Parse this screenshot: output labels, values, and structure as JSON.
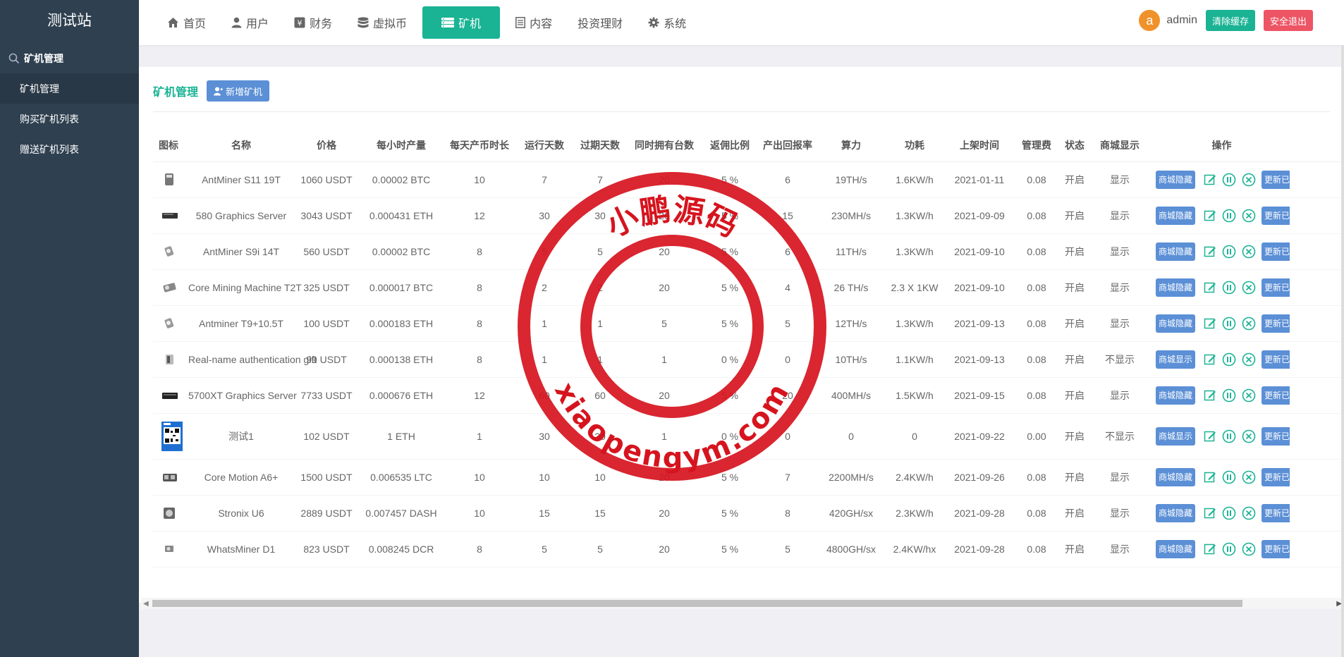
{
  "sidebar": {
    "site_title": "测试站",
    "section": "矿机管理",
    "items": [
      {
        "label": "矿机管理"
      },
      {
        "label": "购买矿机列表"
      },
      {
        "label": "赠送矿机列表"
      }
    ]
  },
  "topnav": {
    "items": [
      {
        "label": "首页",
        "icon": "home-icon"
      },
      {
        "label": "用户",
        "icon": "user-icon"
      },
      {
        "label": "财务",
        "icon": "yen-icon"
      },
      {
        "label": "虚拟币",
        "icon": "database-icon"
      },
      {
        "label": "矿机",
        "icon": "server-icon"
      },
      {
        "label": "内容",
        "icon": "document-icon"
      },
      {
        "label": "投资理财",
        "icon": ""
      },
      {
        "label": "系统",
        "icon": "gear-icon"
      }
    ],
    "active_index": 4,
    "user_initial": "a",
    "username": "admin",
    "clear_cache": "清除缓存",
    "logout": "安全退出"
  },
  "panel": {
    "title": "矿机管理",
    "add_button": "新增矿机"
  },
  "table": {
    "headers": [
      "图标",
      "名称",
      "价格",
      "每小时产量",
      "每天产币时长",
      "运行天数",
      "过期天数",
      "同时拥有台数",
      "返佣比例",
      "产出回报率",
      "算力",
      "功耗",
      "上架时间",
      "管理费",
      "状态",
      "商城显示",
      "操作"
    ],
    "rows": [
      {
        "name": "AntMiner S11 19T",
        "price": "1060 USDT",
        "hourly": "0.00002 BTC",
        "daily_hours": "10",
        "run_days": "7",
        "expire_days": "7",
        "max_units": "20",
        "rebate": "5 %",
        "return_rate": "6",
        "hashrate": "19TH/s",
        "power": "1.6KW/h",
        "listed": "2021-01-11",
        "fee": "0.08",
        "status": "开启",
        "shop": "显示",
        "shop_btn": "商城隐藏",
        "more": "更新已"
      },
      {
        "name": "580 Graphics Server",
        "price": "3043 USDT",
        "hourly": "0.000431 ETH",
        "daily_hours": "12",
        "run_days": "30",
        "expire_days": "30",
        "max_units": "20",
        "rebate": "5 %",
        "return_rate": "15",
        "hashrate": "230MH/s",
        "power": "1.3KW/h",
        "listed": "2021-09-09",
        "fee": "0.08",
        "status": "开启",
        "shop": "显示",
        "shop_btn": "商城隐藏",
        "more": "更新已"
      },
      {
        "name": "AntMiner S9i 14T",
        "price": "560 USDT",
        "hourly": "0.00002 BTC",
        "daily_hours": "8",
        "run_days": "5",
        "expire_days": "5",
        "max_units": "20",
        "rebate": "5 %",
        "return_rate": "6",
        "hashrate": "11TH/s",
        "power": "1.3KW/h",
        "listed": "2021-09-10",
        "fee": "0.08",
        "status": "开启",
        "shop": "显示",
        "shop_btn": "商城隐藏",
        "more": "更新已"
      },
      {
        "name": "Core Mining Machine T2T",
        "price": "325 USDT",
        "hourly": "0.000017 BTC",
        "daily_hours": "8",
        "run_days": "2",
        "expire_days": "2",
        "max_units": "20",
        "rebate": "5 %",
        "return_rate": "4",
        "hashrate": "26 TH/s",
        "power": "2.3 X 1KW",
        "listed": "2021-09-10",
        "fee": "0.08",
        "status": "开启",
        "shop": "显示",
        "shop_btn": "商城隐藏",
        "more": "更新已"
      },
      {
        "name": "Antminer T9+10.5T",
        "price": "100 USDT",
        "hourly": "0.000183 ETH",
        "daily_hours": "8",
        "run_days": "1",
        "expire_days": "1",
        "max_units": "5",
        "rebate": "5 %",
        "return_rate": "5",
        "hashrate": "12TH/s",
        "power": "1.3KW/h",
        "listed": "2021-09-13",
        "fee": "0.08",
        "status": "开启",
        "shop": "显示",
        "shop_btn": "商城隐藏",
        "more": "更新已"
      },
      {
        "name": "Real-name authentication gift",
        "price": "99 USDT",
        "hourly": "0.000138 ETH",
        "daily_hours": "8",
        "run_days": "1",
        "expire_days": "1",
        "max_units": "1",
        "rebate": "0 %",
        "return_rate": "0",
        "hashrate": "10TH/s",
        "power": "1.1KW/h",
        "listed": "2021-09-13",
        "fee": "0.08",
        "status": "开启",
        "shop": "不显示",
        "shop_btn": "商城显示",
        "more": "更新已"
      },
      {
        "name": "5700XT Graphics Server",
        "price": "7733 USDT",
        "hourly": "0.000676 ETH",
        "daily_hours": "12",
        "run_days": "60",
        "expire_days": "60",
        "max_units": "20",
        "rebate": "5 %",
        "return_rate": "20",
        "hashrate": "400MH/s",
        "power": "1.5KW/h",
        "listed": "2021-09-15",
        "fee": "0.08",
        "status": "开启",
        "shop": "显示",
        "shop_btn": "商城隐藏",
        "more": "更新已"
      },
      {
        "name": "测试1",
        "price": "102 USDT",
        "hourly": "1 ETH",
        "daily_hours": "1",
        "run_days": "30",
        "expire_days": "30",
        "max_units": "1",
        "rebate": "0 %",
        "return_rate": "0",
        "hashrate": "0",
        "power": "0",
        "listed": "2021-09-22",
        "fee": "0.00",
        "status": "开启",
        "shop": "不显示",
        "shop_btn": "商城显示",
        "more": "更新已"
      },
      {
        "name": "Core Motion A6+",
        "price": "1500 USDT",
        "hourly": "0.006535 LTC",
        "daily_hours": "10",
        "run_days": "10",
        "expire_days": "10",
        "max_units": "20",
        "rebate": "5 %",
        "return_rate": "7",
        "hashrate": "2200MH/s",
        "power": "2.4KW/h",
        "listed": "2021-09-26",
        "fee": "0.08",
        "status": "开启",
        "shop": "显示",
        "shop_btn": "商城隐藏",
        "more": "更新已"
      },
      {
        "name": "Stronix U6",
        "price": "2889 USDT",
        "hourly": "0.007457 DASH",
        "daily_hours": "10",
        "run_days": "15",
        "expire_days": "15",
        "max_units": "20",
        "rebate": "5 %",
        "return_rate": "8",
        "hashrate": "420GH/sx",
        "power": "2.3KW/h",
        "listed": "2021-09-28",
        "fee": "0.08",
        "status": "开启",
        "shop": "显示",
        "shop_btn": "商城隐藏",
        "more": "更新已"
      },
      {
        "name": "WhatsMiner D1",
        "price": "823 USDT",
        "hourly": "0.008245 DCR",
        "daily_hours": "8",
        "run_days": "5",
        "expire_days": "5",
        "max_units": "20",
        "rebate": "5 %",
        "return_rate": "5",
        "hashrate": "4800GH/sx",
        "power": "2.4KW/hx",
        "listed": "2021-09-28",
        "fee": "0.08",
        "status": "开启",
        "shop": "显示",
        "shop_btn": "商城隐藏",
        "more": "更新已"
      }
    ]
  },
  "watermark": {
    "top_text": "小鹏源码",
    "bottom_text": "xiaopengym.com",
    "color": "#d6141e"
  },
  "colors": {
    "sidebar_bg": "#2f4050",
    "accent_green": "#1ab394",
    "button_blue": "#5b8fd6",
    "danger_red": "#ed5565"
  }
}
